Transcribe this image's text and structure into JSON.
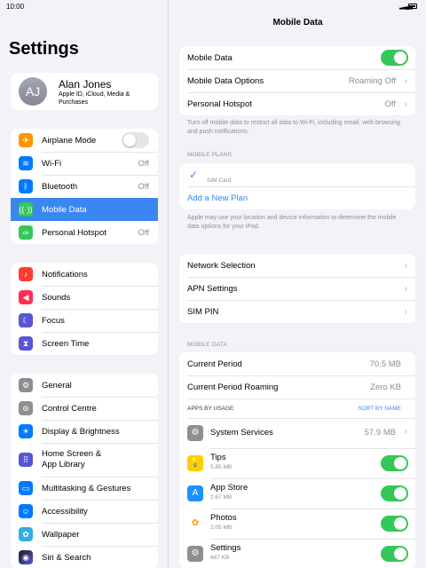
{
  "status": {
    "time": "10:00"
  },
  "sidebar": {
    "title": "Settings",
    "profile": {
      "initials": "AJ",
      "name": "Alan Jones",
      "subtitle": "Apple ID, iCloud, Media & Purchases"
    },
    "group1": [
      {
        "label": "Airplane Mode",
        "icon": "airplane-icon",
        "color": "#ff9500",
        "toggle": "off"
      },
      {
        "label": "Wi-Fi",
        "icon": "wifi-icon",
        "color": "#007aff",
        "value": "Off"
      },
      {
        "label": "Bluetooth",
        "icon": "bluetooth-icon",
        "color": "#007aff",
        "value": "Off"
      },
      {
        "label": "Mobile Data",
        "icon": "antenna-icon",
        "color": "#34c759",
        "selected": true
      },
      {
        "label": "Personal Hotspot",
        "icon": "hotspot-icon",
        "color": "#34c759",
        "value": "Off"
      }
    ],
    "group2": [
      {
        "label": "Notifications",
        "icon": "bell-icon",
        "color": "#ff3b30"
      },
      {
        "label": "Sounds",
        "icon": "speaker-icon",
        "color": "#ff2d55"
      },
      {
        "label": "Focus",
        "icon": "moon-icon",
        "color": "#5856d6"
      },
      {
        "label": "Screen Time",
        "icon": "hourglass-icon",
        "color": "#5856d6"
      }
    ],
    "group3": [
      {
        "label": "General",
        "icon": "gear-icon",
        "color": "#8e8e93"
      },
      {
        "label": "Control Centre",
        "icon": "switches-icon",
        "color": "#8e8e93"
      },
      {
        "label": "Display & Brightness",
        "icon": "sun-icon",
        "color": "#007aff"
      },
      {
        "label": "Home Screen & App Library",
        "line1": "Home Screen &",
        "line2": "App Library",
        "icon": "grid-icon",
        "color": "#5856d6"
      },
      {
        "label": "Multitasking & Gestures",
        "icon": "multitask-icon",
        "color": "#007aff"
      },
      {
        "label": "Accessibility",
        "icon": "accessibility-icon",
        "color": "#007aff"
      },
      {
        "label": "Wallpaper",
        "icon": "flower-icon",
        "color": "#32ade6"
      },
      {
        "label": "Siri & Search",
        "icon": "siri-icon",
        "color": "#1c1c1e"
      }
    ]
  },
  "main": {
    "title": "Mobile Data",
    "top": {
      "mobile_data": "Mobile Data",
      "options_label": "Mobile Data Options",
      "options_value": "Roaming Off",
      "hotspot_label": "Personal Hotspot",
      "hotspot_value": "Off"
    },
    "note1": "Turn off mobile data to restrict all data to Wi-Fi, including email, web browsing and push notifications.",
    "plans_header": "MOBILE PLANS",
    "sim_card": "SIM Card",
    "add_plan": "Add a New Plan",
    "note2": "Apple may use your location and device information to determine the mobile data options for your iPad.",
    "network": {
      "network_selection": "Network Selection",
      "apn_settings": "APN Settings",
      "sim_pin": "SIM PIN"
    },
    "data_header": "MOBILE DATA",
    "usage": {
      "current_period": "Current Period",
      "current_period_value": "70.5 MB",
      "roaming": "Current Period Roaming",
      "roaming_value": "Zero KB",
      "apps_by_usage": "APPS BY USAGE",
      "sort_by_name": "SORT BY NAME"
    },
    "apps": [
      {
        "name": "System Services",
        "value": "57.9 MB",
        "icon": "gear-icon",
        "color": "#8e8e93"
      },
      {
        "name": "Tips",
        "size": "5.85 MB",
        "icon": "lightbulb-icon",
        "color": "#ffcc00"
      },
      {
        "name": "App Store",
        "size": "2.67 MB",
        "icon": "appstore-icon",
        "color": "#1e90ff"
      },
      {
        "name": "Photos",
        "size": "2.05 MB",
        "icon": "photos-icon",
        "color": "#ffffff"
      },
      {
        "name": "Settings",
        "size": "667 KB",
        "icon": "gear-icon",
        "color": "#8e8e93"
      }
    ]
  }
}
